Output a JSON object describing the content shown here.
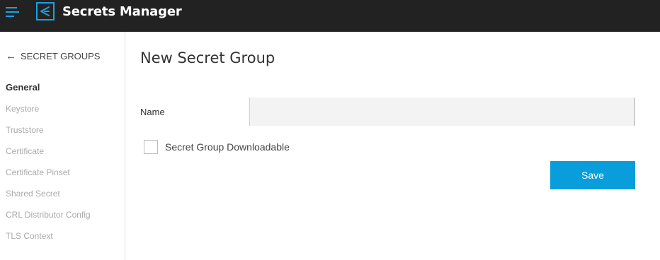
{
  "header": {
    "app_title": "Secrets Manager",
    "menu_icon": "hamburger-menu-icon",
    "logo_icon": "secrets-manager-logo-icon",
    "background_color": "#222222",
    "accent_color": "#1ba1e2"
  },
  "sidebar": {
    "back_label": "SECRET GROUPS",
    "back_icon": "arrow-left-icon",
    "items": [
      {
        "label": "General",
        "active": true
      },
      {
        "label": "Keystore",
        "active": false
      },
      {
        "label": "Truststore",
        "active": false
      },
      {
        "label": "Certificate",
        "active": false
      },
      {
        "label": "Certificate Pinset",
        "active": false
      },
      {
        "label": "Shared Secret",
        "active": false
      },
      {
        "label": "CRL Distributor Config",
        "active": false
      },
      {
        "label": "TLS Context",
        "active": false
      }
    ]
  },
  "main": {
    "title": "New Secret Group",
    "name_label": "Name",
    "name_value": "",
    "downloadable_label": "Secret Group Downloadable",
    "downloadable_checked": false,
    "save_label": "Save",
    "save_color": "#0a9ddb"
  }
}
